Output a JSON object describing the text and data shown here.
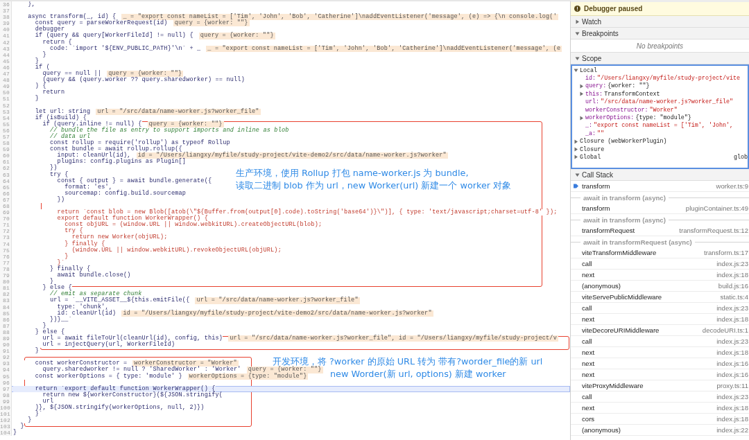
{
  "editor": {
    "lines": [
      {
        "number": "36",
        "code": "    },",
        "kind": "code"
      },
      {
        "number": "37"
      },
      {
        "number": "38",
        "code": "    async transform(_, id) {",
        "kind": "code",
        "value": "_ = \"export const nameList = ['Tim', 'John', 'Bob', 'Catherine']\\naddEventListener('message', (e) => {\\n console.log('"
      },
      {
        "number": "39",
        "code": "      const query = parseWorkerRequest(id)",
        "kind": "code",
        "value": "query = {worker: \"\"}"
      },
      {
        "number": "40",
        "code": "      debugger",
        "kind": "code"
      },
      {
        "number": "41",
        "code": "      if (query && query[WorkerFileId] != null) {",
        "kind": "code",
        "value": "query = {worker: \"\"}"
      },
      {
        "number": "42",
        "code": "        return {",
        "kind": "code"
      },
      {
        "number": "43",
        "code": "          code: `import '${ENV_PUBLIC_PATH}'\\n` + _",
        "kind": "code",
        "value": "_ = \"export const nameList = ['Tim', 'John', 'Bob', 'Catherine']\\naddEventListener('message', (e"
      },
      {
        "number": "44",
        "code": "        }",
        "kind": "code"
      },
      {
        "number": "45",
        "code": "      }",
        "kind": "code"
      },
      {
        "number": "46",
        "code": "      if (",
        "kind": "code"
      },
      {
        "number": "47",
        "code": "        query == null ||",
        "kind": "code",
        "value": "query = {worker: \"\"}"
      },
      {
        "number": "48",
        "code": "        (query && (query.worker ?? query.sharedworker) == null)",
        "kind": "code"
      },
      {
        "number": "49",
        "code": "      ) {",
        "kind": "code"
      },
      {
        "number": "50",
        "code": "        return",
        "kind": "code"
      },
      {
        "number": "51",
        "code": "      }",
        "kind": "code"
      },
      {
        "number": "52"
      },
      {
        "number": "53",
        "code": "      let url: string",
        "kind": "code",
        "value": "url = \"/src/data/name-worker.js?worker_file\""
      },
      {
        "number": "54",
        "code": "      if (isBuild) {",
        "kind": "code"
      },
      {
        "number": "55",
        "code": "        if (query.inline != null) {",
        "kind": "code",
        "value": "query = {worker: \"\"}"
      },
      {
        "number": "56",
        "code": "          // bundle the file as entry to support imports and inline as blob",
        "kind": "comment"
      },
      {
        "number": "57",
        "code": "          // data url",
        "kind": "comment"
      },
      {
        "number": "58",
        "code": "          const rollup = require('rollup') as typeof Rollup",
        "kind": "code"
      },
      {
        "number": "59",
        "code": "          const bundle = await rollup.rollup({",
        "kind": "code"
      },
      {
        "number": "60",
        "code": "            input: cleanUrl(id),",
        "kind": "code",
        "value": "id = \"/Users/liangxy/myfile/study-project/vite-demo2/src/data/name-worker.js?worker\""
      },
      {
        "number": "61",
        "code": "            plugins: config.plugins as Plugin[]",
        "kind": "code"
      },
      {
        "number": "62",
        "code": "          })",
        "kind": "code"
      },
      {
        "number": "63",
        "code": "          try {",
        "kind": "code"
      },
      {
        "number": "64",
        "code": "            const { output } = await bundle.generate({",
        "kind": "code"
      },
      {
        "number": "65",
        "code": "              format: 'es',",
        "kind": "code"
      },
      {
        "number": "66",
        "code": "              sourcemap: config.build.sourcemap",
        "kind": "code"
      },
      {
        "number": "67",
        "code": "            })",
        "kind": "code"
      },
      {
        "number": "68"
      },
      {
        "number": "69",
        "code": "            return `const blob = new Blob([atob(\\\"${Buffer.from(output[0].code).toString('base64')}\\\")], { type: 'text/javascript;charset=utf-8' });",
        "kind": "string"
      },
      {
        "number": "70",
        "code": "            export default function WorkerWrapper() {",
        "kind": "string"
      },
      {
        "number": "71",
        "code": "              const objURL = (window.URL || window.webkitURL).createObjectURL(blob);",
        "kind": "string"
      },
      {
        "number": "72",
        "code": "              try {",
        "kind": "string"
      },
      {
        "number": "73",
        "code": "                return new Worker(objURL);",
        "kind": "string"
      },
      {
        "number": "74",
        "code": "              } finally {",
        "kind": "string"
      },
      {
        "number": "75",
        "code": "                (window.URL || window.webkitURL).revokeObjectURL(objURL);",
        "kind": "string"
      },
      {
        "number": "76",
        "code": "              }",
        "kind": "string"
      },
      {
        "number": "77",
        "code": "            }`",
        "kind": "string"
      },
      {
        "number": "78",
        "code": "          } finally {",
        "kind": "code"
      },
      {
        "number": "79",
        "code": "            await bundle.close()",
        "kind": "code"
      },
      {
        "number": "80",
        "code": "          }",
        "kind": "code"
      },
      {
        "number": "81",
        "code": "        } else {",
        "kind": "code"
      },
      {
        "number": "82",
        "code": "          // emit as separate chunk",
        "kind": "comment"
      },
      {
        "number": "83",
        "code": "          url = `__VITE_ASSET__${this.emitFile({",
        "kind": "code",
        "value": "url = \"/src/data/name-worker.js?worker_file\""
      },
      {
        "number": "84",
        "code": "            type: 'chunk',",
        "kind": "code"
      },
      {
        "number": "85",
        "code": "            id: cleanUrl(id)",
        "kind": "code",
        "value": "id = \"/Users/liangxy/myfile/study-project/vite-demo2/src/data/name-worker.js?worker\""
      },
      {
        "number": "86",
        "code": "          })}__`",
        "kind": "code"
      },
      {
        "number": "87",
        "code": "        }",
        "kind": "code"
      },
      {
        "number": "88",
        "code": "      } else {",
        "kind": "code"
      },
      {
        "number": "89",
        "code": "        url = await fileToUrl(cleanUrl(id), config, this)",
        "kind": "code",
        "value": "url = \"/src/data/name-worker.js?worker_file\", id = \"/Users/liangxy/myfile/study-project/v"
      },
      {
        "number": "90",
        "code": "        url = injectQuery(url, WorkerFileId)",
        "kind": "code"
      },
      {
        "number": "91",
        "code": "      }",
        "kind": "code"
      },
      {
        "number": "92"
      },
      {
        "number": "93",
        "code": "      const workerConstructor =",
        "kind": "code",
        "value": "workerConstructor = \"Worker\""
      },
      {
        "number": "94",
        "code": "        query.sharedworker != null ? 'SharedWorker' : 'Worker'",
        "kind": "code",
        "value": "query = {worker: \"\"}"
      },
      {
        "number": "95",
        "code": "      const workerOptions = { type: 'module' }",
        "kind": "code",
        "value": "workerOptions = {type: \"module\"}"
      },
      {
        "number": "96"
      },
      {
        "number": "97",
        "code": "      return `export default function WorkerWrapper() {",
        "kind": "code",
        "current": true
      },
      {
        "number": "98",
        "code": "        return new ${workerConstructor}(${JSON.stringify(",
        "kind": "code"
      },
      {
        "number": "99",
        "code": "        url",
        "kind": "code"
      },
      {
        "number": "100",
        "code": "      )}, ${JSON.stringify(workerOptions, null, 2)})",
        "kind": "code"
      },
      {
        "number": "101",
        "code": "      }`",
        "kind": "code"
      },
      {
        "number": "102",
        "code": "    }",
        "kind": "code"
      },
      {
        "number": "103",
        "code": "  }",
        "kind": "code"
      },
      {
        "number": "104",
        "code": "}",
        "kind": "code"
      }
    ],
    "annotations": [
      {
        "lines": [
          "生产环境，使用 Rollup 打包 name-worker.js 为 bundle,",
          "读取二进制 blob 作为 url，new Worker(url) 新建一个 worker 对象"
        ]
      },
      {
        "lines": [
          "开发环境，将 ?worker 的原始 URL 转为 带有?worder_file的新 url",
          "new Worder(新 url, options) 新建 worker"
        ]
      }
    ]
  },
  "debugger": {
    "status": "Debugger paused",
    "watch": {
      "title": "Watch",
      "expanded": false
    },
    "breakpoints": {
      "title": "Breakpoints",
      "expanded": true,
      "empty_text": "No breakpoints"
    },
    "scope": {
      "title": "Scope",
      "expanded": true,
      "tree": [
        {
          "name": "Local",
          "expanded": true,
          "children": [
            {
              "name": "id:",
              "value": "\"/Users/liangxy/myfile/study-project/vite",
              "kind": "string"
            },
            {
              "name": "query:",
              "value": "{worker: \"\"}",
              "kind": "object",
              "expanded": false
            },
            {
              "name": "this:",
              "value": "TransformContext",
              "kind": "object",
              "expanded": false
            },
            {
              "name": "url:",
              "value": "\"/src/data/name-worker.js?worker_file\"",
              "kind": "string"
            },
            {
              "name": "workerConstructor:",
              "value": "\"Worker\"",
              "kind": "string"
            },
            {
              "name": "workerOptions:",
              "value": "{type: \"module\"}",
              "kind": "object",
              "expanded": false
            },
            {
              "name": "_:",
              "value": "\"export const nameList = ['Tim', 'John',",
              "kind": "string"
            },
            {
              "name": "_a:",
              "value": "\"\"",
              "kind": "string"
            }
          ]
        },
        {
          "name": "Closure (webWorkerPlugin)",
          "expanded": false
        },
        {
          "name": "Closure",
          "expanded": false
        },
        {
          "name": "Global",
          "expanded": false,
          "value": "glob",
          "kind": "right"
        }
      ]
    },
    "call_stack": {
      "title": "Call Stack",
      "expanded": true,
      "frames": [
        {
          "kind": "frame",
          "name": "transform",
          "location": "worker.ts:9",
          "current": true
        },
        {
          "kind": "async",
          "label": "await in transform (async)"
        },
        {
          "kind": "frame",
          "name": "transform",
          "location": "pluginContainer.ts:49",
          "current": false
        },
        {
          "kind": "async",
          "label": "await in transform (async)"
        },
        {
          "kind": "frame",
          "name": "transformRequest",
          "location": "transformRequest.ts:12",
          "current": false
        },
        {
          "kind": "async",
          "label": "await in transformRequest (async)"
        },
        {
          "kind": "frame",
          "name": "viteTransformMiddleware",
          "location": "transform.ts:17",
          "current": false
        },
        {
          "kind": "frame",
          "name": "call",
          "location": "index.js:23",
          "current": false
        },
        {
          "kind": "frame",
          "name": "next",
          "location": "index.js:18",
          "current": false
        },
        {
          "kind": "frame",
          "name": "(anonymous)",
          "location": "build.js:16",
          "current": false
        },
        {
          "kind": "frame",
          "name": "viteServePublicMiddleware",
          "location": "static.ts:4",
          "current": false
        },
        {
          "kind": "frame",
          "name": "call",
          "location": "index.js:23",
          "current": false
        },
        {
          "kind": "frame",
          "name": "next",
          "location": "index.js:18",
          "current": false
        },
        {
          "kind": "frame",
          "name": "viteDecoreURIMiddleware",
          "location": "decodeURI.ts:1",
          "current": false
        },
        {
          "kind": "frame",
          "name": "call",
          "location": "index.js:23",
          "current": false
        },
        {
          "kind": "frame",
          "name": "next",
          "location": "index.js:18",
          "current": false
        },
        {
          "kind": "frame",
          "name": "next",
          "location": "index.js:16",
          "current": false
        },
        {
          "kind": "frame",
          "name": "next",
          "location": "index.js:16",
          "current": false
        },
        {
          "kind": "frame",
          "name": "viteProxyMiddleware",
          "location": "proxy.ts:11",
          "current": false
        },
        {
          "kind": "frame",
          "name": "call",
          "location": "index.js:23",
          "current": false
        },
        {
          "kind": "frame",
          "name": "next",
          "location": "index.js:18",
          "current": false
        },
        {
          "kind": "frame",
          "name": "cors",
          "location": "index.js:18",
          "current": false
        },
        {
          "kind": "frame",
          "name": "(anonymous)",
          "location": "index.js:22",
          "current": false
        }
      ]
    }
  }
}
